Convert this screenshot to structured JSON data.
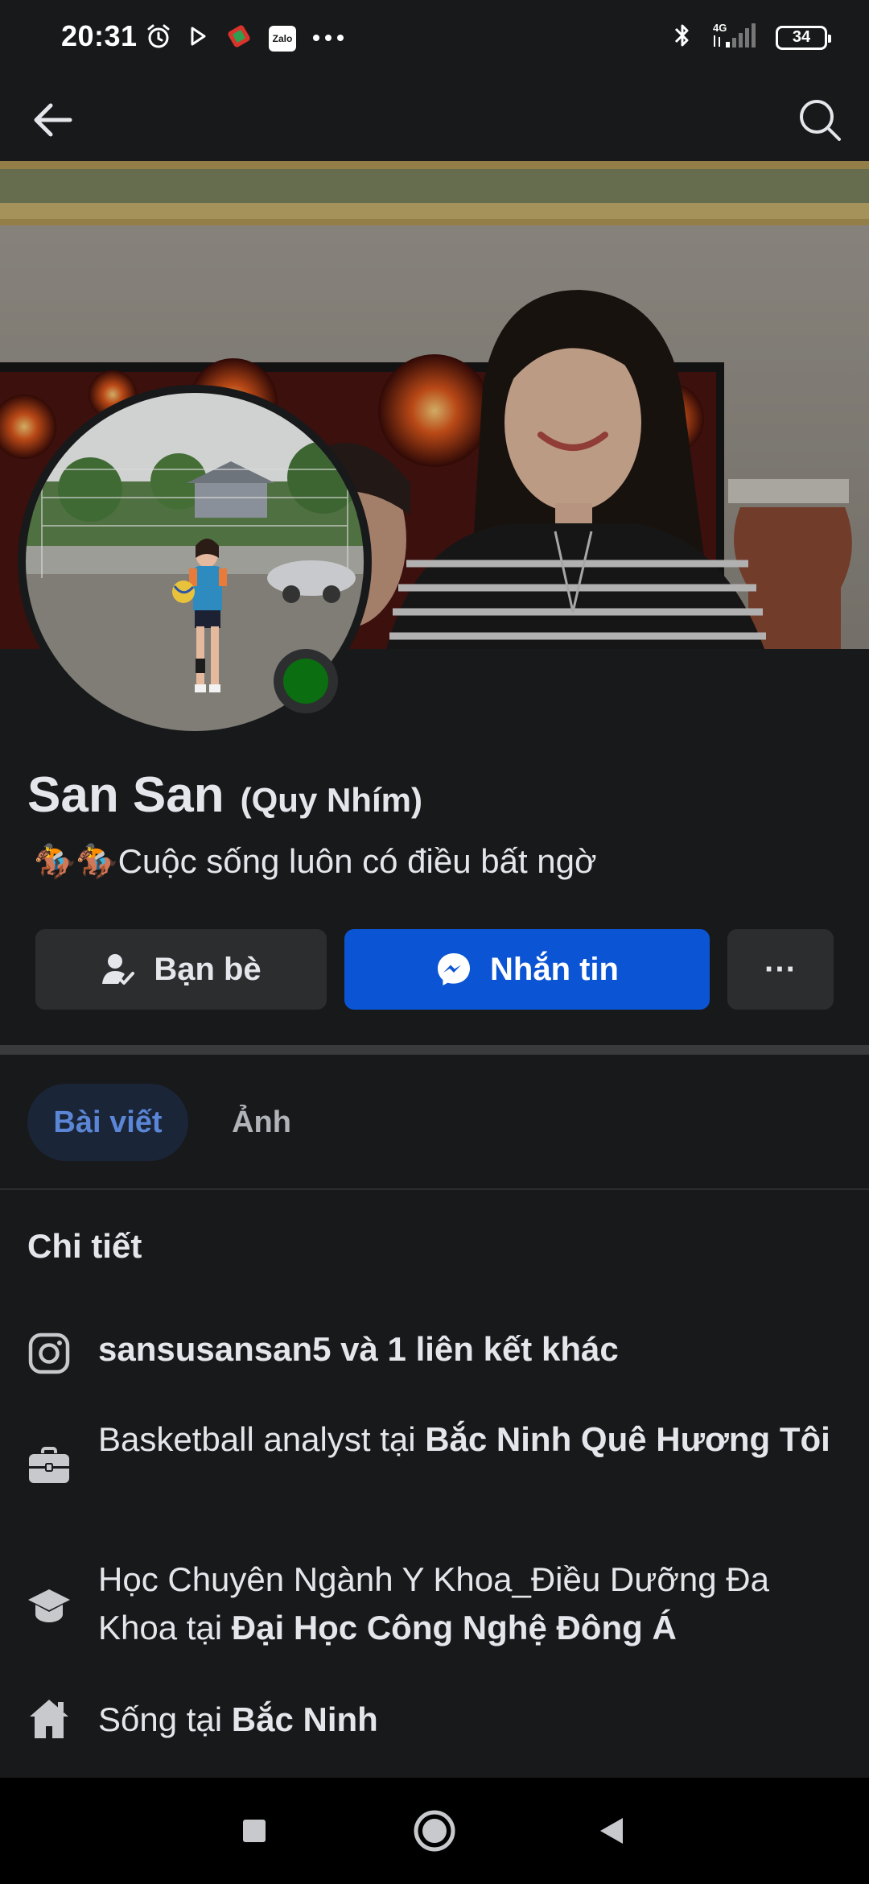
{
  "status_bar": {
    "time": "20:31",
    "zalo": "Zalo",
    "network": "4G",
    "battery": "34"
  },
  "profile": {
    "name": "San San",
    "alternate_name": "(Quy Nhím)",
    "bio": "🏇🏇Cuộc sống luôn có điều bất ngờ"
  },
  "actions": {
    "friends_label": "Bạn bè",
    "message_label": "Nhắn tin",
    "more_label": "···"
  },
  "tabs": {
    "posts": "Bài viết",
    "photos": "Ảnh"
  },
  "details": {
    "title": "Chi tiết",
    "instagram": "sansusansan5 và 1 liên kết khác",
    "work_prefix": "Basketball analyst tại ",
    "work_place": "Bắc Ninh Quê Hương Tôi",
    "education_prefix": "Học Chuyên Ngành Y Khoa_Điều Dưỡng Đa Khoa tại ",
    "education_place": "Đại Học Công Nghệ Đông Á",
    "lives_prefix": "Sống tại ",
    "lives_place": "Bắc Ninh"
  },
  "colors": {
    "background": "#18191a",
    "primary_button": "#0b55d4",
    "online_status": "#0b6e10",
    "active_tab_text": "#5b86d6"
  },
  "icons": [
    "alarm-icon",
    "play-icon",
    "app-icon",
    "bluetooth-icon",
    "signal-icon",
    "battery-icon",
    "back-arrow-icon",
    "search-icon",
    "friend-check-icon",
    "messenger-icon",
    "instagram-icon",
    "briefcase-icon",
    "graduation-cap-icon",
    "home-icon",
    "nav-recents-icon",
    "nav-home-icon",
    "nav-back-icon"
  ]
}
